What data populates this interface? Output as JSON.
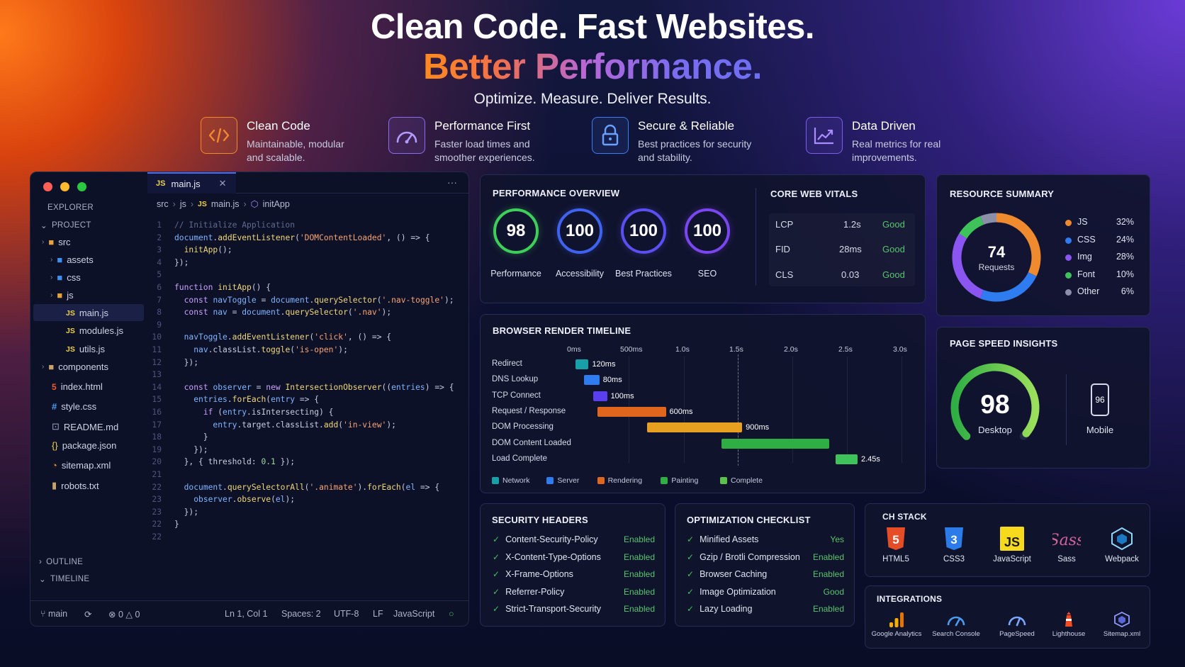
{
  "hero": {
    "line1": "Clean Code. Fast Websites.",
    "line2": "Better Performance.",
    "subtitle": "Optimize. Measure. Deliver Results."
  },
  "features": [
    {
      "icon": "code-brackets-icon",
      "title": "Clean Code",
      "desc": "Maintainable, modular\nand scalable."
    },
    {
      "icon": "speedometer-icon",
      "title": "Performance First",
      "desc": "Faster load times and\nsmoother experiences."
    },
    {
      "icon": "lock-icon",
      "title": "Secure & Reliable",
      "desc": "Best practices for security\nand stability."
    },
    {
      "icon": "trend-chart-icon",
      "title": "Data Driven",
      "desc": "Real metrics for real\nimprovements."
    }
  ],
  "editor": {
    "tab": "main.js",
    "tab_lang": "JS",
    "more": "···",
    "breadcrumb": [
      "src",
      "js",
      "main.js",
      "initApp"
    ],
    "explorer": {
      "header": "EXPLORER",
      "project": "PROJECT",
      "outline": "OUTLINE",
      "timeline": "TIMELINE",
      "items": [
        "src",
        "assets",
        "css",
        "js",
        "main.js",
        "modules.js",
        "utils.js",
        "components",
        "index.html",
        "style.css",
        "README.md",
        "package.json",
        "sitemap.xml",
        "robots.txt"
      ]
    },
    "code": [
      "// Initialize Application",
      "document.addEventListener('DOMContentLoaded', () => {",
      "  initApp();",
      "});",
      "",
      "function initApp() {",
      "  const navToggle = document.querySelector('.nav-toggle');",
      "  const nav = document.querySelector('.nav');",
      "",
      "  navToggle.addEventListener('click', () => {",
      "    nav.classList.toggle('is-open');",
      "  });",
      "",
      "  const observer = new IntersectionObserver((entries) => {",
      "    entries.forEach(entry => {",
      "      if (entry.isIntersecting) {",
      "        entry.target.classList.add('in-view');",
      "      }",
      "    });",
      "  }, { threshold: 0.1 });",
      "",
      "  document.querySelectorAll('.animate').forEach(el => {",
      "    observer.observe(el);",
      "  });",
      "}",
      ""
    ],
    "line_numbers": [
      "1",
      "2",
      "3",
      "4",
      "5",
      "6",
      "7",
      "8",
      "9",
      "10",
      "11",
      "12",
      "13",
      "14",
      "15",
      "16",
      "17",
      "18",
      "19",
      "20",
      "21",
      "22",
      "23",
      "23",
      "22",
      "22"
    ],
    "status": {
      "branch": "main",
      "errors": "0",
      "warnings": "0",
      "position": "Ln 1, Col 1",
      "spaces": "Spaces: 2",
      "encoding": "UTF-8",
      "eol": "LF",
      "language": "JavaScript"
    }
  },
  "performance": {
    "title": "PERFORMANCE OVERVIEW",
    "scores": [
      {
        "value": "98",
        "label": "Performance",
        "color": "#3ecf5a"
      },
      {
        "value": "100",
        "label": "Accessibility",
        "color": "#3f63f0"
      },
      {
        "value": "100",
        "label": "Best Practices",
        "color": "#5a4ff0"
      },
      {
        "value": "100",
        "label": "SEO",
        "color": "#7a46f0"
      }
    ]
  },
  "vitals": {
    "title": "CORE WEB VITALS",
    "rows": [
      {
        "name": "LCP",
        "value": "1.2s",
        "status": "Good"
      },
      {
        "name": "FID",
        "value": "28ms",
        "status": "Good"
      },
      {
        "name": "CLS",
        "value": "0.03",
        "status": "Good"
      }
    ]
  },
  "resources": {
    "title": "RESOURCE SUMMARY",
    "total": "74",
    "total_label": "Requests",
    "items": [
      {
        "name": "JS",
        "pct": "32%",
        "value": 32,
        "color": "#f08a2e"
      },
      {
        "name": "CSS",
        "pct": "24%",
        "value": 24,
        "color": "#2f7cf0"
      },
      {
        "name": "Img",
        "pct": "28%",
        "value": 28,
        "color": "#8a55f0"
      },
      {
        "name": "Font",
        "pct": "10%",
        "value": 10,
        "color": "#3ec25a"
      },
      {
        "name": "Other",
        "pct": "6%",
        "value": 6,
        "color": "#8b90a8"
      }
    ]
  },
  "timeline": {
    "title": "BROWSER RENDER TIMELINE",
    "axis": [
      "0ms",
      "500ms",
      "1.0s",
      "1.5s",
      "2.0s",
      "2.5s",
      "3.0s"
    ],
    "rows": [
      {
        "name": "Redirect",
        "start": 0,
        "dur": 120,
        "label": "120ms",
        "color": "#17a0a8"
      },
      {
        "name": "DNS Lookup",
        "start": 80,
        "dur": 140,
        "label": "80ms",
        "color": "#2f7cf0"
      },
      {
        "name": "TCP Connect",
        "start": 160,
        "dur": 130,
        "label": "100ms",
        "color": "#5a3ff0"
      },
      {
        "name": "Request / Response",
        "start": 200,
        "dur": 630,
        "label": "600ms",
        "color": "#e0651d"
      },
      {
        "name": "DOM Processing",
        "start": 660,
        "dur": 870,
        "label": "900ms",
        "color": "#e8a020"
      },
      {
        "name": "DOM Content Loaded",
        "start": 1340,
        "dur": 990,
        "label": "",
        "color": "#2fae43"
      },
      {
        "name": "Load Complete",
        "start": 2390,
        "dur": 200,
        "label": "2.45s",
        "color": "#3ec25a"
      }
    ],
    "legend": [
      {
        "name": "Network",
        "color": "#17a0a8"
      },
      {
        "name": "Server",
        "color": "#2f7cf0"
      },
      {
        "name": "Rendering",
        "color": "#e0651d"
      },
      {
        "name": "Painting",
        "color": "#2fae43"
      },
      {
        "name": "Complete",
        "color": "#5bc24e"
      }
    ]
  },
  "pagespeed": {
    "title": "PAGE SPEED INSIGHTS",
    "desktop_score": "98",
    "desktop_label": "Desktop",
    "mobile_score": "96",
    "mobile_label": "Mobile",
    "desktop_fraction": 0.98
  },
  "security": {
    "title": "SECURITY HEADERS",
    "items": [
      {
        "name": "Content-Security-Policy",
        "status": "Enabled"
      },
      {
        "name": "X-Content-Type-Options",
        "status": "Enabled"
      },
      {
        "name": "X-Frame-Options",
        "status": "Enabled"
      },
      {
        "name": "Referrer-Policy",
        "status": "Enabled"
      },
      {
        "name": "Strict-Transport-Security",
        "status": "Enabled"
      }
    ]
  },
  "optimization": {
    "title": "OPTIMIZATION CHECKLIST",
    "items": [
      {
        "name": "Minified Assets",
        "status": "Yes"
      },
      {
        "name": "Gzip / Brotli Compression",
        "status": "Enabled"
      },
      {
        "name": "Browser Caching",
        "status": "Enabled"
      },
      {
        "name": "Image Optimization",
        "status": "Good"
      },
      {
        "name": "Lazy Loading",
        "status": "Enabled"
      }
    ]
  },
  "techstack": {
    "title": "CH STACK",
    "items": [
      "HTML5",
      "CSS3",
      "JavaScript",
      "Sass",
      "Webpack"
    ]
  },
  "integrations": {
    "title": "INTEGRATIONS",
    "items": [
      "Google Analytics",
      "Search Console",
      "PageSpeed",
      "Lighthouse",
      "Sitemap.xml"
    ]
  }
}
